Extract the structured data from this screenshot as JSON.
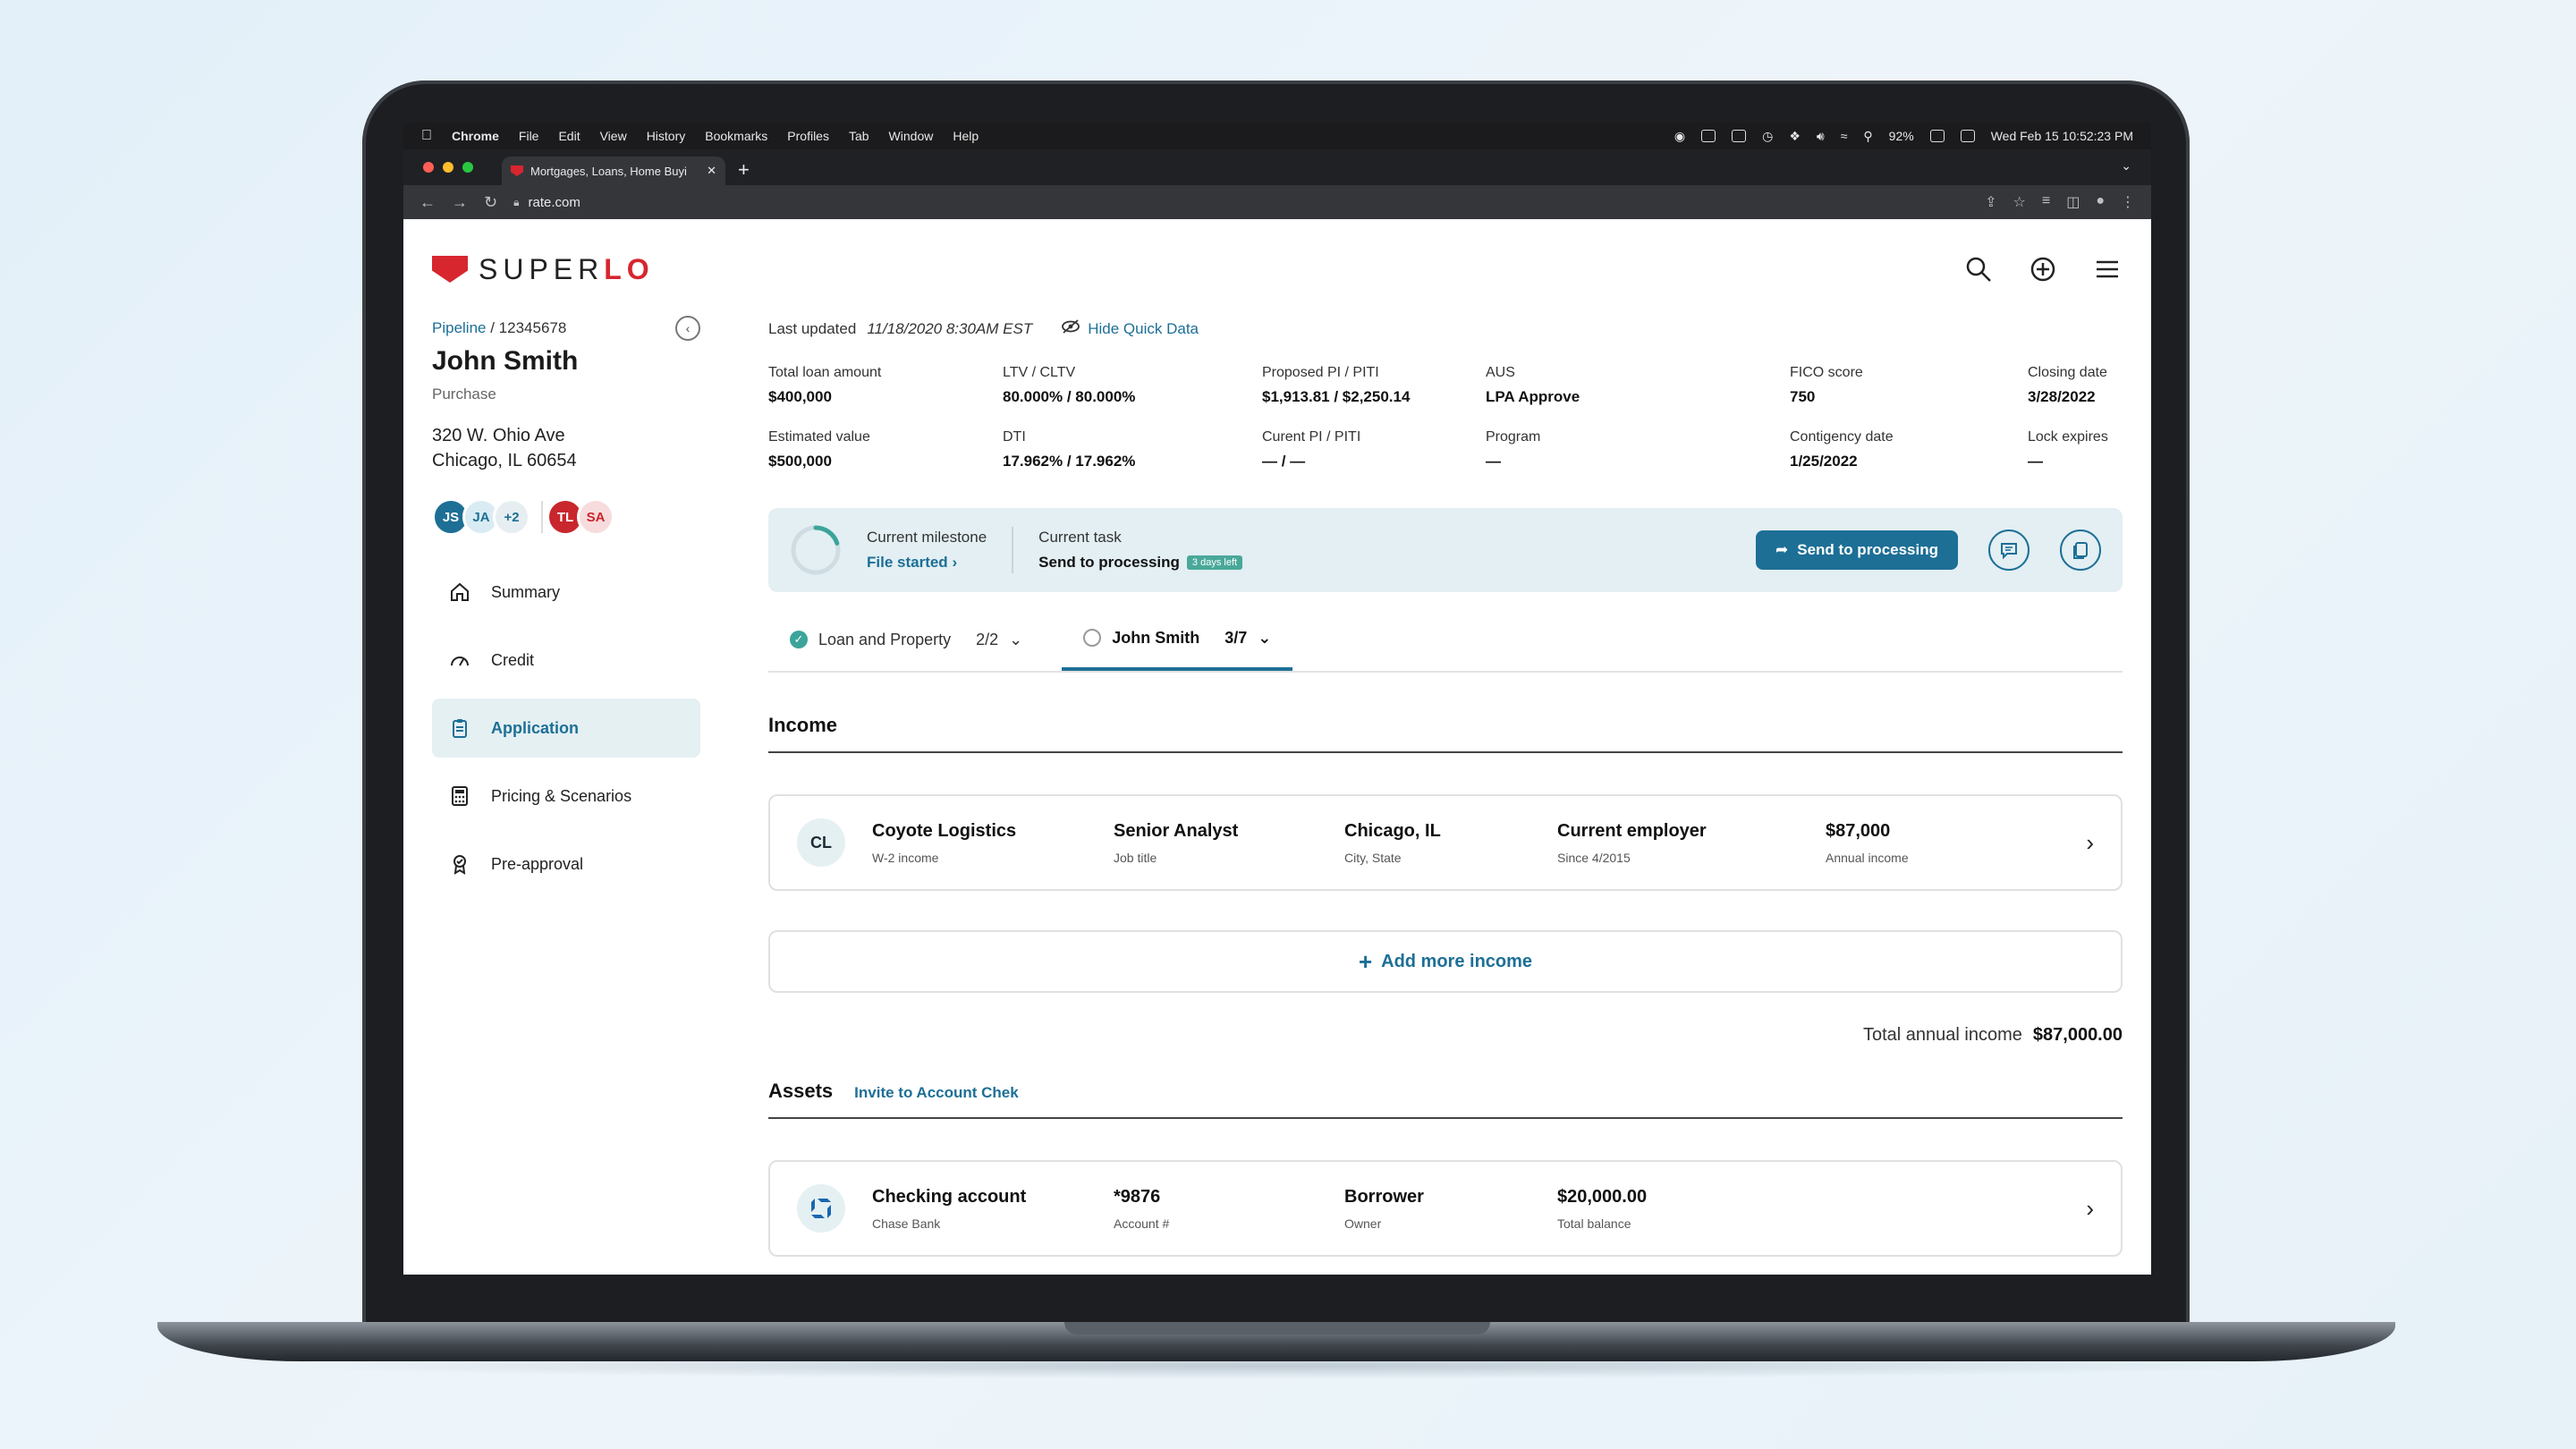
{
  "menubar": {
    "app_name": "Chrome",
    "menus": [
      "File",
      "Edit",
      "View",
      "History",
      "Bookmarks",
      "Profiles",
      "Tab",
      "Window",
      "Help"
    ],
    "battery": "92%",
    "datetime": "Wed Feb 15  10:52:23 PM"
  },
  "browser": {
    "tab_title": "Mortgages, Loans, Home Buyi",
    "url": "rate.com"
  },
  "brand": {
    "logo_text_a": "SUPER",
    "logo_text_b": "LO"
  },
  "sidebar": {
    "breadcrumb_link": "Pipeline",
    "breadcrumb_sep": " / ",
    "loan_id": "12345678",
    "borrower_name": "John Smith",
    "loan_purpose": "Purchase",
    "address_line1": "320 W. Ohio Ave",
    "address_line2": "Chicago, IL 60654",
    "avatars": [
      "JS",
      "JA",
      "+2",
      "TL",
      "SA"
    ],
    "nav": [
      {
        "label": "Summary"
      },
      {
        "label": "Credit"
      },
      {
        "label": "Application"
      },
      {
        "label": "Pricing & Scenarios"
      },
      {
        "label": "Pre-approval"
      }
    ]
  },
  "quick_data": {
    "last_updated_label": "Last updated",
    "last_updated_value": "11/18/2020 8:30AM EST",
    "hide_label": "Hide Quick Data",
    "fields": [
      {
        "label": "Total loan amount",
        "value": "$400,000"
      },
      {
        "label": "LTV / CLTV",
        "value": "80.000% / 80.000%"
      },
      {
        "label": "Proposed PI / PITI",
        "value": "$1,913.81 / $2,250.14"
      },
      {
        "label": "AUS",
        "value": "LPA Approve"
      },
      {
        "label": "FICO score",
        "value": "750"
      },
      {
        "label": "Closing date",
        "value": "3/28/2022"
      },
      {
        "label": "Estimated value",
        "value": "$500,000"
      },
      {
        "label": "DTI",
        "value": "17.962% / 17.962%"
      },
      {
        "label": "Curent PI / PITI",
        "value": "— / —"
      },
      {
        "label": "Program",
        "value": "—"
      },
      {
        "label": "Contigency date",
        "value": "1/25/2022"
      },
      {
        "label": "Lock expires",
        "value": "—"
      }
    ]
  },
  "milestone": {
    "label": "Current milestone",
    "value": "File started",
    "progress": 0.2,
    "task_label": "Current task",
    "task_value": "Send to processing",
    "task_badge": "3 days left",
    "action_label": "Send to processing"
  },
  "tabs": [
    {
      "label": "Loan and Property",
      "count": "2/2"
    },
    {
      "label": "John Smith",
      "count": "3/7"
    }
  ],
  "income": {
    "title": "Income",
    "card": {
      "initials": "CL",
      "employer": "Coyote Logistics",
      "employer_sub": "W-2 income",
      "job_title": "Senior Analyst",
      "job_title_sub": "Job title",
      "location": "Chicago, IL",
      "location_sub": "City, State",
      "status": "Current employer",
      "status_sub": "Since 4/2015",
      "amount": "$87,000",
      "amount_sub": "Annual income"
    },
    "add_more_label": "Add more income",
    "total_label": "Total annual income",
    "total_value": "$87,000.00"
  },
  "assets": {
    "title": "Assets",
    "invite_label": "Invite to Account Chek",
    "card": {
      "account_type": "Checking account",
      "bank": "Chase Bank",
      "account_number": "*9876",
      "account_number_sub": "Account #",
      "owner": "Borrower",
      "owner_sub": "Owner",
      "balance": "$20,000.00",
      "balance_sub": "Total balance"
    }
  },
  "colors": {
    "accent": "#1d6f96",
    "brand_red": "#d7262e",
    "success": "#3ca49a"
  }
}
